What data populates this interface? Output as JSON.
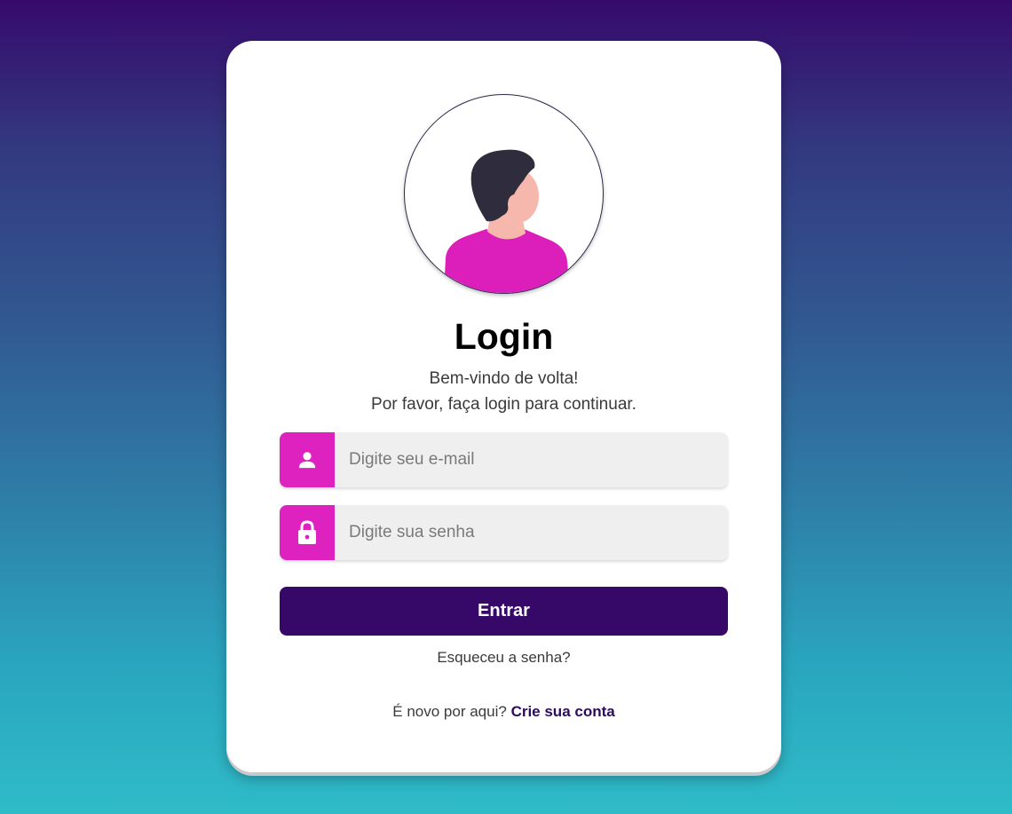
{
  "login": {
    "title": "Login",
    "subtitle_line1": "Bem-vindo de volta!",
    "subtitle_line2": "Por favor, faça login para continuar.",
    "email_placeholder": "Digite seu e-mail",
    "password_placeholder": "Digite sua senha",
    "submit_label": "Entrar",
    "forgot_label": "Esqueceu a senha?",
    "signup_prompt": "É novo por aqui?",
    "signup_link": "Crie sua conta"
  },
  "icons": {
    "email": "user-icon",
    "password": "lock-icon",
    "avatar": "person-avatar"
  },
  "colors": {
    "accent": "#dd22bf",
    "button": "#360868",
    "link": "#2d0b5c",
    "input_bg": "#efefef"
  }
}
